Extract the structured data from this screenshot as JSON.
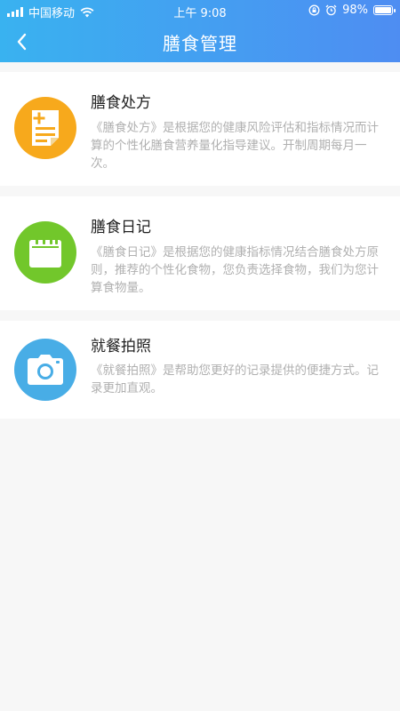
{
  "status_bar": {
    "carrier": "中国移动",
    "time": "上午 9:08",
    "battery_percent": "98%",
    "battery_level": 0.98
  },
  "header": {
    "title": "膳食管理",
    "back_icon": "chevron-left-icon"
  },
  "colors": {
    "header_start": "#39b2f0",
    "header_end": "#4e8df2",
    "prescription": "#f7a91c",
    "diary": "#72c72b",
    "photo": "#48ade6"
  },
  "items": [
    {
      "title": "膳食处方",
      "icon": "prescription-doc-icon",
      "description": "《膳食处方》是根据您的健康风险评估和指标情况而计算的个性化膳食营养量化指导建议。开制周期每月一次。"
    },
    {
      "title": "膳食日记",
      "icon": "calendar-icon",
      "description": "《膳食日记》是根据您的健康指标情况结合膳食处方原则，推荐的个性化食物，您负责选择食物，我们为您计算食物量。"
    },
    {
      "title": "就餐拍照",
      "icon": "camera-icon",
      "description": "《就餐拍照》是帮助您更好的记录提供的便捷方式。记录更加直观。"
    }
  ]
}
